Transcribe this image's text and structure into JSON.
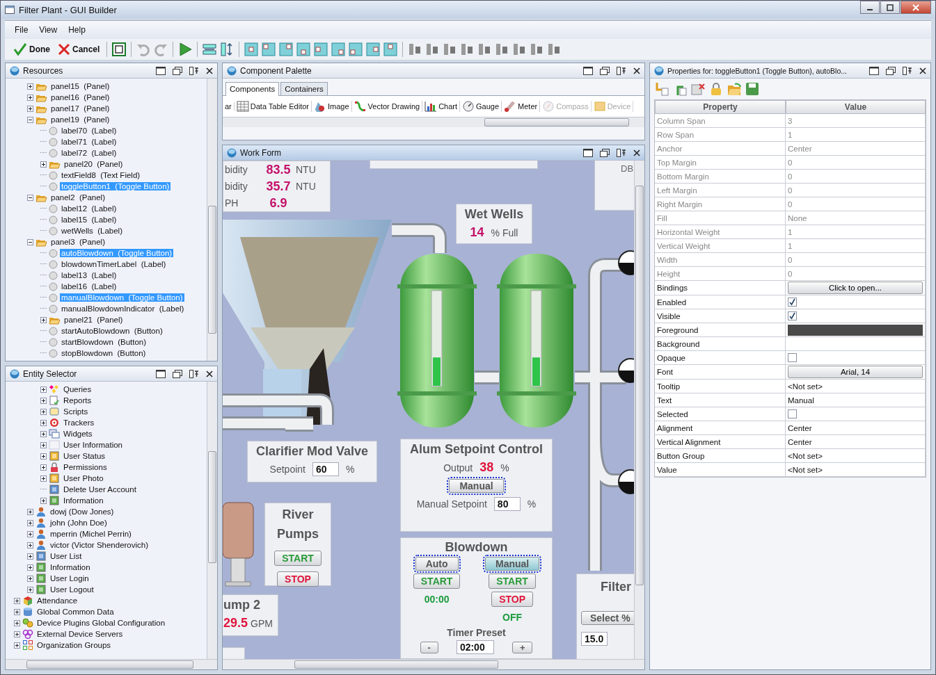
{
  "window": {
    "title": "Filter Plant - GUI Builder"
  },
  "menu": [
    "File",
    "View",
    "Help"
  ],
  "toolbar": {
    "done": "Done",
    "cancel": "Cancel",
    "tools": [
      {
        "kind": "frame",
        "disabled": false
      },
      {
        "kind": "undo",
        "disabled": true
      },
      {
        "kind": "redo",
        "disabled": true
      },
      {
        "kind": "run",
        "disabled": false
      },
      {
        "kind": "fit-width",
        "disabled": false
      },
      {
        "kind": "fit-height",
        "disabled": false
      },
      {
        "kind": "anchor",
        "disabled": false
      },
      {
        "kind": "anchor",
        "disabled": false
      },
      {
        "kind": "anchor",
        "disabled": false
      },
      {
        "kind": "anchor",
        "disabled": false
      },
      {
        "kind": "anchor",
        "disabled": false
      },
      {
        "kind": "anchor",
        "disabled": false
      },
      {
        "kind": "anchor",
        "disabled": false
      },
      {
        "kind": "anchor",
        "disabled": false
      },
      {
        "kind": "anchor",
        "disabled": false
      },
      {
        "kind": "align",
        "disabled": false
      },
      {
        "kind": "align",
        "disabled": false
      },
      {
        "kind": "align",
        "disabled": false
      },
      {
        "kind": "align",
        "disabled": false
      },
      {
        "kind": "align",
        "disabled": false
      },
      {
        "kind": "align",
        "disabled": false
      },
      {
        "kind": "align",
        "disabled": false
      },
      {
        "kind": "align",
        "disabled": false
      },
      {
        "kind": "align",
        "disabled": false
      }
    ]
  },
  "resources": {
    "title": "Resources",
    "items": [
      {
        "children": [
          {
            "label": "panel15  (Panel)",
            "kind": "panel",
            "expanded": false,
            "selected": false
          },
          {
            "label": "panel16  (Panel)",
            "kind": "panel",
            "expanded": false,
            "selected": false
          },
          {
            "label": "panel17  (Panel)",
            "kind": "panel",
            "expanded": false,
            "selected": false
          },
          {
            "label": "panel19  (Panel)",
            "kind": "panel",
            "expanded": true,
            "selected": false,
            "children": [
              {
                "label": "label70  (Label)",
                "kind": "component",
                "selected": false
              },
              {
                "label": "label71  (Label)",
                "kind": "component",
                "selected": false
              },
              {
                "label": "label72  (Label)",
                "kind": "component",
                "selected": false
              },
              {
                "label": "panel20  (Panel)",
                "kind": "panel",
                "expanded": false,
                "selected": false
              },
              {
                "label": "textField8  (Text Field)",
                "kind": "component",
                "selected": false
              },
              {
                "label": "toggleButton1  (Toggle Button)",
                "kind": "component",
                "selected": true
              }
            ]
          },
          {
            "label": "panel2  (Panel)",
            "kind": "panel",
            "expanded": true,
            "selected": false,
            "children": [
              {
                "label": "label12  (Label)",
                "kind": "component",
                "selected": false
              },
              {
                "label": "label15  (Label)",
                "kind": "component",
                "selected": false
              },
              {
                "label": "wetWells  (Label)",
                "kind": "component",
                "selected": false
              }
            ]
          },
          {
            "label": "panel3  (Panel)",
            "kind": "panel",
            "expanded": true,
            "selected": false,
            "children": [
              {
                "label": "autoBlowdown  (Toggle Button)",
                "kind": "component",
                "selected": true
              },
              {
                "label": "blowdownTimerLabel  (Label)",
                "kind": "component",
                "selected": false
              },
              {
                "label": "label13  (Label)",
                "kind": "component",
                "selected": false
              },
              {
                "label": "label16  (Label)",
                "kind": "component",
                "selected": false
              },
              {
                "label": "manualBlowdown  (Toggle Button)",
                "kind": "component",
                "selected": true
              },
              {
                "label": "manualBlowdownIndicator  (Label)",
                "kind": "component",
                "selected": false
              },
              {
                "label": "panel21  (Panel)",
                "kind": "panel",
                "expanded": false,
                "selected": false
              },
              {
                "label": "startAutoBlowdown  (Button)",
                "kind": "component",
                "selected": false
              },
              {
                "label": "startBlowdown  (Button)",
                "kind": "component",
                "selected": false
              },
              {
                "label": "stopBlowdown  (Button)",
                "kind": "component",
                "selected": false
              }
            ]
          }
        ]
      }
    ]
  },
  "entities": {
    "title": "Entity Selector",
    "items": [
      {
        "children": [
          {
            "children": [
              {
                "label": "Queries",
                "kind": "query",
                "expanded": false,
                "selected": false
              },
              {
                "label": "Reports",
                "kind": "report",
                "expanded": false,
                "selected": false
              },
              {
                "label": "Scripts",
                "kind": "script",
                "expanded": false,
                "selected": false
              },
              {
                "label": "Trackers",
                "kind": "tracker",
                "expanded": false,
                "selected": false
              },
              {
                "label": "Widgets",
                "kind": "widget",
                "expanded": false,
                "selected": false
              },
              {
                "label": "User Information",
                "kind": "form",
                "expanded": false,
                "selected": false
              },
              {
                "label": "User Status",
                "kind": "status",
                "expanded": false,
                "selected": false
              },
              {
                "label": "Permissions",
                "kind": "lock",
                "expanded": false,
                "selected": false
              },
              {
                "label": "User Photo",
                "kind": "status",
                "expanded": false,
                "selected": false
              },
              {
                "label": "Delete User Account",
                "kind": "function",
                "selected": false
              },
              {
                "label": "Information",
                "kind": "event",
                "expanded": false,
                "selected": false
              }
            ]
          },
          {
            "label": "dowj (Dow Jones)",
            "kind": "user",
            "expanded": false,
            "selected": false
          },
          {
            "label": "john (John Doe)",
            "kind": "user",
            "expanded": false,
            "selected": false
          },
          {
            "label": "mperrin (Michel Perrin)",
            "kind": "user",
            "expanded": false,
            "selected": false
          },
          {
            "label": "victor (Victor Shenderovich)",
            "kind": "user",
            "expanded": false,
            "selected": false
          },
          {
            "label": "User List",
            "kind": "function",
            "expanded": false,
            "selected": false
          },
          {
            "label": "Information",
            "kind": "event",
            "expanded": false,
            "selected": false
          },
          {
            "label": "User Login",
            "kind": "event",
            "expanded": false,
            "selected": false
          },
          {
            "label": "User Logout",
            "kind": "event",
            "expanded": false,
            "selected": false
          }
        ]
      },
      {
        "label": "Attendance",
        "kind": "cube",
        "expanded": false,
        "selected": false
      },
      {
        "label": "Global Common Data",
        "kind": "database",
        "expanded": false,
        "selected": false
      },
      {
        "label": "Device Plugins Global Configuration",
        "kind": "gears",
        "expanded": false,
        "selected": false
      },
      {
        "label": "External Device Servers",
        "kind": "cluster",
        "expanded": false,
        "selected": false
      },
      {
        "label": "Organization Groups",
        "kind": "grid",
        "expanded": false,
        "selected": false
      }
    ]
  },
  "palette": {
    "title": "Component Palette",
    "tabs": [
      {
        "label": "Components",
        "selected": true
      },
      {
        "label": "Containers",
        "selected": false
      }
    ],
    "items": [
      {
        "label": "ar",
        "kind": "cut",
        "disabled": false
      },
      {
        "label": "Data Table Editor",
        "kind": "table",
        "disabled": false
      },
      {
        "label": "Image",
        "kind": "image",
        "disabled": false
      },
      {
        "label": "Vector Drawing",
        "kind": "vector",
        "disabled": false
      },
      {
        "label": "Chart",
        "kind": "chart",
        "disabled": false
      },
      {
        "label": "Gauge",
        "kind": "gauge",
        "disabled": false
      },
      {
        "label": "Meter",
        "kind": "meter",
        "disabled": false
      },
      {
        "label": "Compass",
        "kind": "compass",
        "disabled": true
      },
      {
        "label": "Device",
        "kind": "device",
        "disabled": true
      }
    ]
  },
  "work_form": {
    "title": "Work Form",
    "readings": [
      {
        "label": "bidity",
        "value": "83.5",
        "unit": "NTU"
      },
      {
        "label": "bidity",
        "value": "35.7",
        "unit": "NTU"
      },
      {
        "label": "PH",
        "value": "6.9"
      }
    ],
    "db_label": "DB",
    "tanks": [
      {
        "level": 0.3
      },
      {
        "level": 0.3
      }
    ],
    "wet_wells": {
      "title": "Wet Wells",
      "value": "14",
      "unit": "% Full"
    },
    "clarifier": {
      "title": "Clarifier Mod Valve",
      "label": "Setpoint",
      "value": "60",
      "unit": "%"
    },
    "alum": {
      "title": "Alum Setpoint Control",
      "output_label": "Output",
      "output": "38",
      "output_unit": "%",
      "mode_button": {
        "label": "Manual",
        "selected": true,
        "pressed": false
      },
      "setpoint_label": "Manual Setpoint",
      "setpoint": "80",
      "setpoint_unit": "%"
    },
    "river_pumps": {
      "title": "River Pumps",
      "buttons": [
        {
          "label": "START",
          "kind": "start"
        },
        {
          "label": "STOP",
          "kind": "stop"
        }
      ]
    },
    "pump2": {
      "title": "ump 2",
      "value": "29.5",
      "unit": "GPM"
    },
    "blowdown": {
      "title": "Blowdown",
      "columns": [
        {
          "mode": {
            "label": "Auto",
            "selected": true,
            "pressed": false
          },
          "buttons": [
            {
              "label": "START",
              "kind": "start"
            }
          ],
          "status": "00:00"
        },
        {
          "mode": {
            "label": "Manual",
            "selected": true,
            "pressed": true
          },
          "buttons": [
            {
              "label": "START",
              "kind": "start"
            },
            {
              "label": "STOP",
              "kind": "stop"
            }
          ],
          "status": "OFF"
        }
      ],
      "timer_label": "Timer Preset",
      "minus": "-",
      "timer": "02:00",
      "plus": "+"
    },
    "filter": {
      "title": "Filter",
      "button": "Select %",
      "value": "15.0"
    }
  },
  "properties": {
    "title": "Properties for: toggleButton1 (Toggle Button), autoBlo...",
    "columns": [
      "Property",
      "Value"
    ],
    "rows": [
      {
        "name": "Column Span",
        "kind": "text",
        "value": "3",
        "disabled": true
      },
      {
        "name": "Row Span",
        "kind": "text",
        "value": "1",
        "disabled": true
      },
      {
        "name": "Anchor",
        "kind": "text",
        "value": "Center",
        "disabled": true
      },
      {
        "name": "Top Margin",
        "kind": "text",
        "value": "0",
        "disabled": true
      },
      {
        "name": "Bottom Margin",
        "kind": "text",
        "value": "0",
        "disabled": true
      },
      {
        "name": "Left Margin",
        "kind": "text",
        "value": "0",
        "disabled": true
      },
      {
        "name": "Right Margin",
        "kind": "text",
        "value": "0",
        "disabled": true
      },
      {
        "name": "Fill",
        "kind": "text",
        "value": "None",
        "disabled": true
      },
      {
        "name": "Horizontal Weight",
        "kind": "text",
        "value": "1",
        "disabled": true
      },
      {
        "name": "Vertical Weight",
        "kind": "text",
        "value": "1",
        "disabled": true
      },
      {
        "name": "Width",
        "kind": "text",
        "value": "0",
        "disabled": true
      },
      {
        "name": "Height",
        "kind": "text",
        "value": "0",
        "disabled": true
      },
      {
        "name": "Bindings",
        "kind": "button",
        "value": "Click to open...",
        "disabled": false
      },
      {
        "name": "Enabled",
        "kind": "check",
        "checked": true,
        "disabled": false
      },
      {
        "name": "Visible",
        "kind": "check",
        "checked": true,
        "disabled": false
      },
      {
        "name": "Foreground",
        "kind": "color",
        "color": "#4a4a4a",
        "disabled": false
      },
      {
        "name": "Background",
        "kind": "empty",
        "disabled": false
      },
      {
        "name": "Opaque",
        "kind": "check",
        "checked": false,
        "disabled": false
      },
      {
        "name": "Font",
        "kind": "button",
        "value": "Arial, 14",
        "disabled": false
      },
      {
        "name": "Tooltip",
        "kind": "text",
        "value": "<Not set>",
        "disabled": false
      },
      {
        "name": "Text",
        "kind": "text",
        "value": "Manual",
        "disabled": false
      },
      {
        "name": "Selected",
        "kind": "check",
        "checked": false,
        "disabled": false
      },
      {
        "name": "Alignment",
        "kind": "text",
        "value": "Center",
        "disabled": false
      },
      {
        "name": "Vertical Alignment",
        "kind": "text",
        "value": "Center",
        "disabled": false
      },
      {
        "name": "Button Group",
        "kind": "text",
        "value": "<Not set>",
        "disabled": false
      },
      {
        "name": "Value",
        "kind": "text",
        "value": "<Not set>",
        "disabled": false
      }
    ]
  }
}
